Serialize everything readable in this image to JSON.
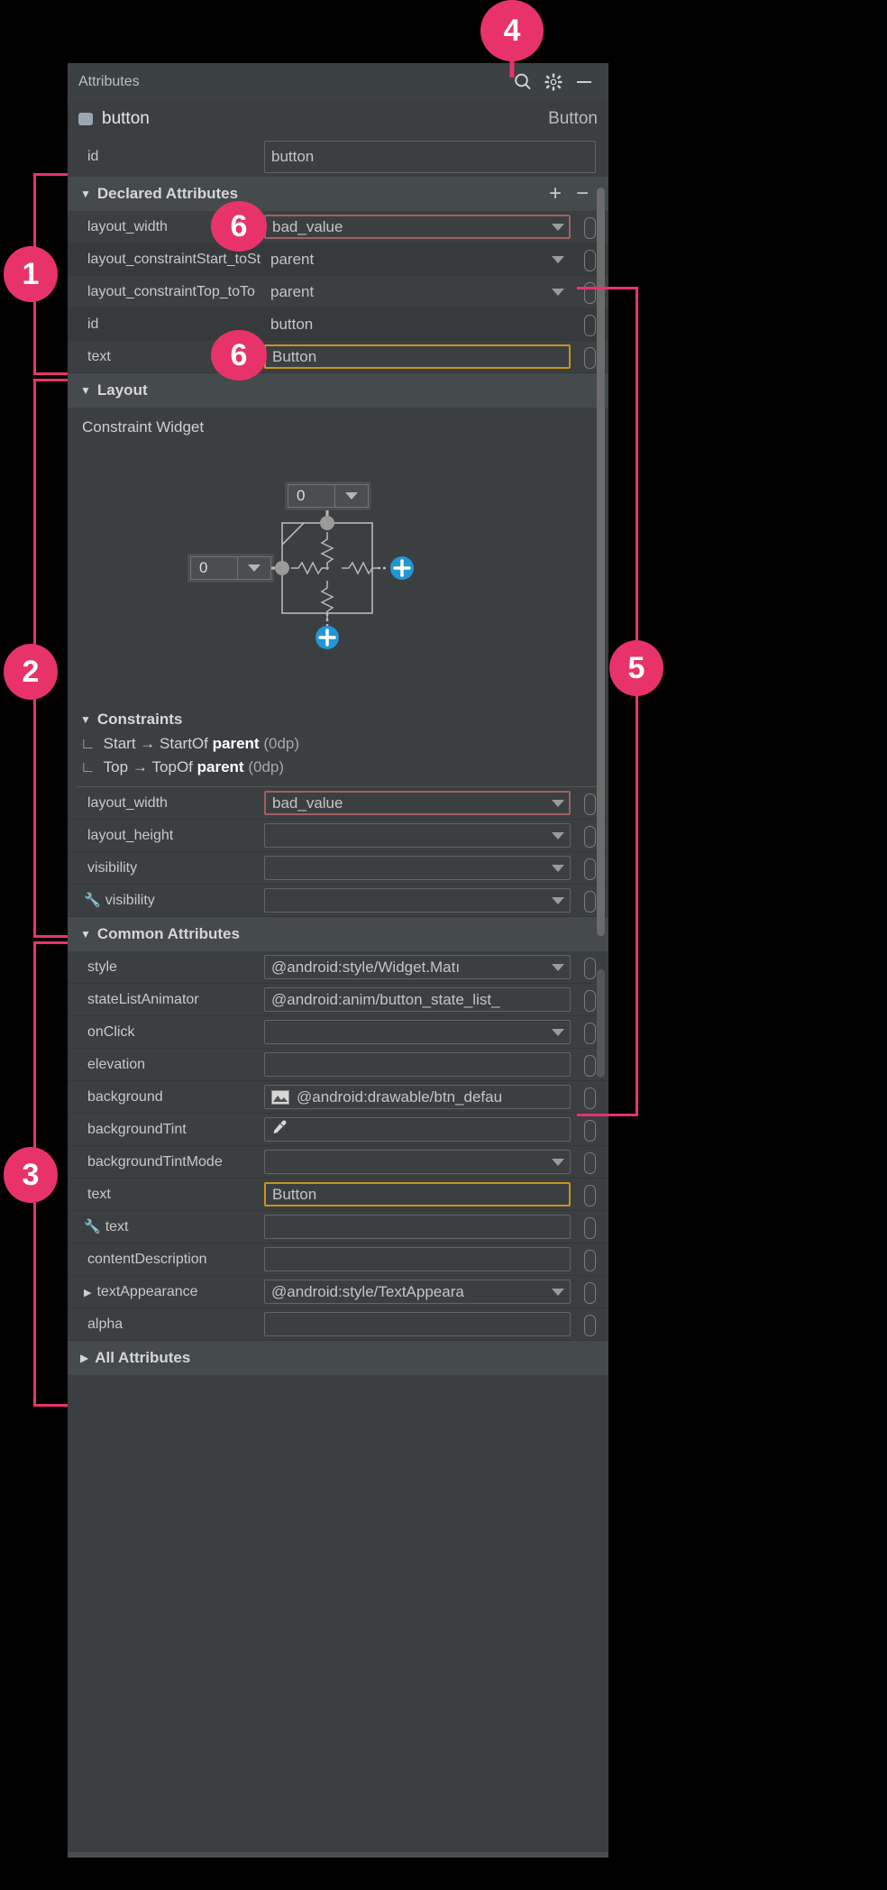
{
  "panel": {
    "title": "Attributes",
    "icons": [
      "search-icon",
      "gear-icon",
      "minimize-icon"
    ],
    "component": {
      "name": "button",
      "class": "Button",
      "swatch_color": "#9aa7b0"
    }
  },
  "id_row": {
    "label": "id",
    "value": "button"
  },
  "declared": {
    "title": "Declared Attributes",
    "add_label": "+",
    "remove_label": "−",
    "rows": [
      {
        "label": "layout_width",
        "value": "bad_value",
        "combo": true,
        "state": "error"
      },
      {
        "label": "layout_constraintStart_toSt",
        "value": "parent",
        "combo": true,
        "state": "none"
      },
      {
        "label": "layout_constraintTop_toTo",
        "value": "parent",
        "combo": true,
        "state": "none"
      },
      {
        "label": "id",
        "value": "button",
        "combo": false,
        "state": "none"
      },
      {
        "label": "text",
        "value": "Button",
        "combo": false,
        "state": "warn"
      }
    ]
  },
  "layout": {
    "title": "Layout",
    "widget_title": "Constraint Widget",
    "top_margin": "0",
    "start_margin": "0"
  },
  "constraints": {
    "title": "Constraints",
    "items": [
      {
        "icon": "constraint-icon",
        "from": "Start",
        "arrow": "→",
        "to": "StartOf",
        "target": "parent",
        "value": "(0dp)"
      },
      {
        "icon": "constraint-icon",
        "from": "Top",
        "arrow": "→",
        "to": "TopOf",
        "target": "parent",
        "value": "(0dp)"
      }
    ]
  },
  "layout_rows": [
    {
      "label": "layout_width",
      "value": "bad_value",
      "combo": true,
      "state": "error",
      "wrench": false
    },
    {
      "label": "layout_height",
      "value": "",
      "combo": true,
      "state": "none",
      "wrench": false
    },
    {
      "label": "visibility",
      "value": "",
      "combo": true,
      "state": "none",
      "wrench": false
    },
    {
      "label": "visibility",
      "value": "",
      "combo": true,
      "state": "none",
      "wrench": true
    }
  ],
  "common": {
    "title": "Common Attributes",
    "rows": [
      {
        "label": "style",
        "value": "@android:style/Widget.Matı",
        "combo": true,
        "state": "none",
        "wrench": false,
        "icon": ""
      },
      {
        "label": "stateListAnimator",
        "value": "@android:anim/button_state_list_",
        "combo": false,
        "state": "none",
        "wrench": false,
        "icon": ""
      },
      {
        "label": "onClick",
        "value": "",
        "combo": true,
        "state": "none",
        "wrench": false,
        "icon": ""
      },
      {
        "label": "elevation",
        "value": "",
        "combo": false,
        "state": "none",
        "wrench": false,
        "icon": ""
      },
      {
        "label": "background",
        "value": "@android:drawable/btn_defau",
        "combo": false,
        "state": "none",
        "wrench": false,
        "icon": "image-icon"
      },
      {
        "label": "backgroundTint",
        "value": "",
        "combo": false,
        "state": "none",
        "wrench": false,
        "icon": "eyedropper-icon"
      },
      {
        "label": "backgroundTintMode",
        "value": "",
        "combo": true,
        "state": "none",
        "wrench": false,
        "icon": ""
      },
      {
        "label": "text",
        "value": "Button",
        "combo": false,
        "state": "warn",
        "wrench": false,
        "icon": ""
      },
      {
        "label": "text",
        "value": "",
        "combo": false,
        "state": "none",
        "wrench": true,
        "icon": ""
      },
      {
        "label": "contentDescription",
        "value": "",
        "combo": false,
        "state": "none",
        "wrench": false,
        "icon": ""
      },
      {
        "label": "textAppearance",
        "value": "@android:style/TextAppeara",
        "combo": true,
        "state": "none",
        "wrench": false,
        "icon": "",
        "expand": true
      },
      {
        "label": "alpha",
        "value": "",
        "combo": false,
        "state": "none",
        "wrench": false,
        "icon": ""
      }
    ]
  },
  "all_attributes": {
    "title": "All Attributes"
  },
  "annotations": [
    {
      "id": "1",
      "label": "1"
    },
    {
      "id": "2",
      "label": "2"
    },
    {
      "id": "3",
      "label": "3"
    },
    {
      "id": "4",
      "label": "4"
    },
    {
      "id": "5",
      "label": "5"
    },
    {
      "id": "6a",
      "label": "6"
    },
    {
      "id": "6b",
      "label": "6"
    }
  ],
  "colors": {
    "accent": "#e8336a",
    "error_border": "#a06060",
    "warn_border": "#c8931f",
    "panel_bg": "#3c3f41",
    "section_bg": "#454a4c",
    "blue": "#2196d6"
  }
}
